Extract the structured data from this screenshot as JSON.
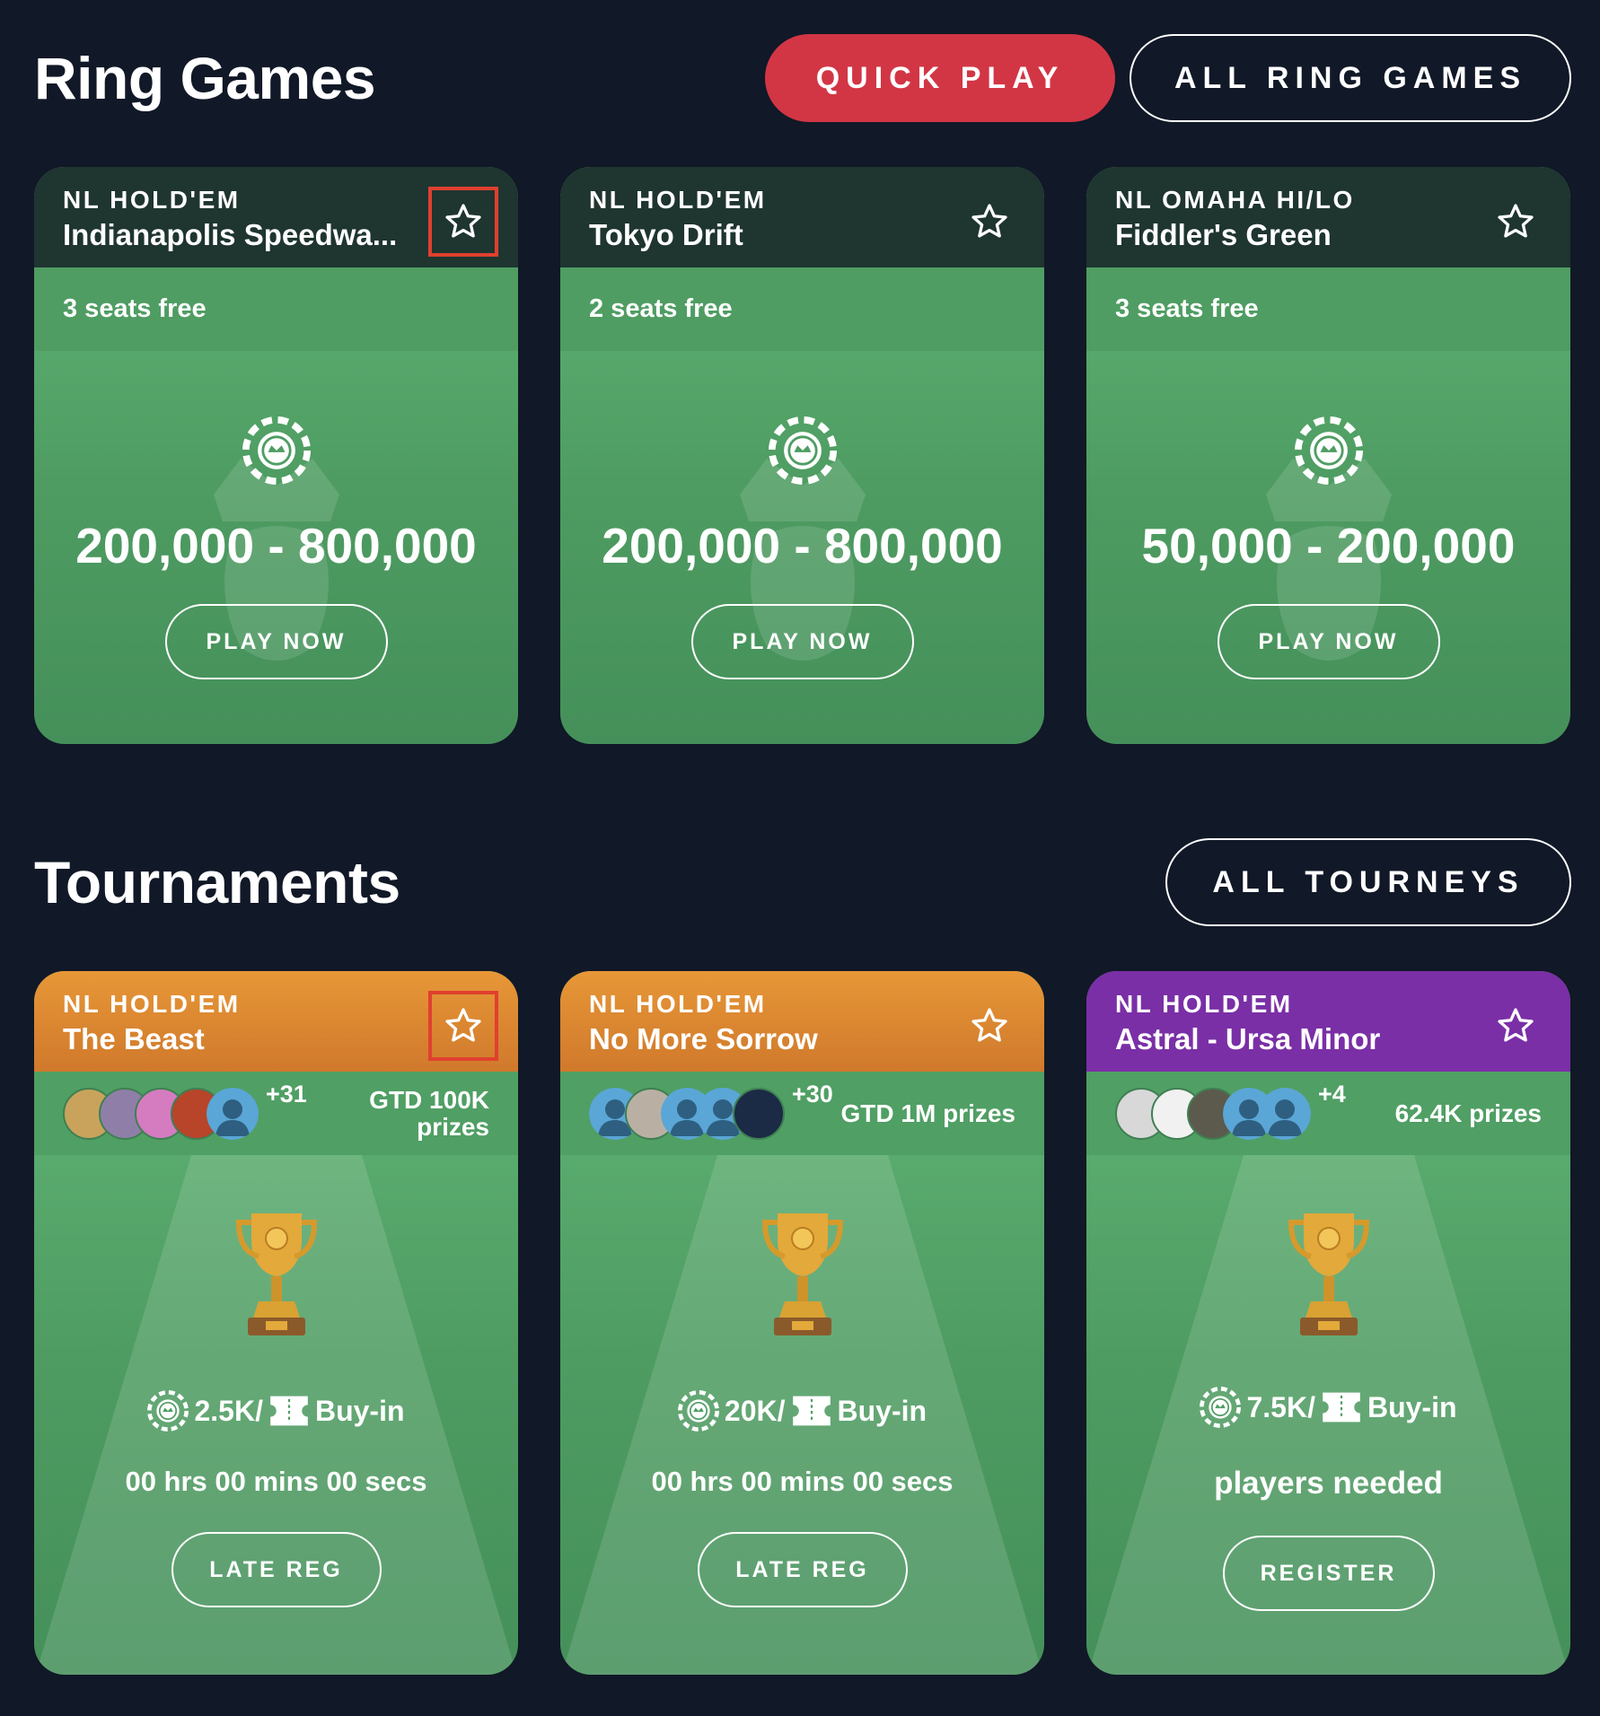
{
  "ring_games": {
    "title": "Ring Games",
    "quick_play_label": "QUICK PLAY",
    "all_label": "ALL RING GAMES",
    "cards": [
      {
        "game_type": "NL HOLD'EM",
        "name": "Indianapolis Speedwa...",
        "seats": "3 seats free",
        "stakes": "200,000 - 800,000",
        "button": "PLAY NOW"
      },
      {
        "game_type": "NL HOLD'EM",
        "name": "Tokyo Drift",
        "seats": "2 seats free",
        "stakes": "200,000 - 800,000",
        "button": "PLAY NOW"
      },
      {
        "game_type": "NL OMAHA HI/LO",
        "name": "Fiddler's Green",
        "seats": "3 seats free",
        "stakes": "50,000 - 200,000",
        "button": "PLAY NOW"
      }
    ]
  },
  "tournaments": {
    "title": "Tournaments",
    "all_label": "ALL TOURNEYS",
    "cards": [
      {
        "game_type": "NL HOLD'EM",
        "name": "The Beast",
        "extra_players": "+31",
        "prizes_line1": "GTD 100K",
        "prizes_line2": "prizes",
        "buyin_amount": "2.5K/",
        "buyin_label": "Buy-in",
        "status": "00 hrs 00 mins 00 secs",
        "button": "LATE REG"
      },
      {
        "game_type": "NL HOLD'EM",
        "name": "No More Sorrow",
        "extra_players": "+30",
        "prizes_line1": "GTD 1M prizes",
        "prizes_line2": "",
        "buyin_amount": "20K/",
        "buyin_label": "Buy-in",
        "status": "00 hrs 00 mins 00 secs",
        "button": "LATE REG"
      },
      {
        "game_type": "NL HOLD'EM",
        "name": "Astral - Ursa Minor",
        "extra_players": "+4",
        "prizes_line1": "62.4K prizes",
        "prizes_line2": "",
        "buyin_amount": "7.5K/",
        "buyin_label": "Buy-in",
        "status": "players needed",
        "button": "REGISTER"
      }
    ]
  },
  "colors": {
    "background": "#111827",
    "quick_play": "#d23645",
    "card_green": "#5aae6f",
    "header_dark": "#1f3530",
    "header_orange": "#e08a33",
    "header_purple": "#7a2fa6",
    "highlight_box": "#e0402f"
  },
  "icons": [
    "star-icon",
    "chip-icon",
    "trophy-icon",
    "ticket-icon",
    "avatar-icon"
  ]
}
